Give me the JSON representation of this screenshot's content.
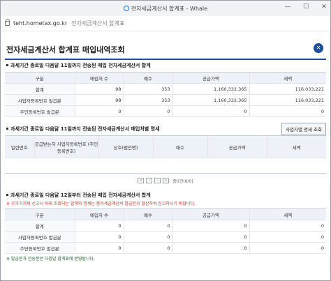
{
  "window": {
    "title": "전자세금계산서 합계표 - Whale"
  },
  "address": {
    "host": "teht.hometax.go.kr",
    "page_title": "전자세금계산서 합계표"
  },
  "header": {
    "title": "전자세금계산서 합계표 매입내역조회"
  },
  "section1": {
    "title": "과세기간 종료일 다음달 11일까지 전송된 매입 전자세금계산서 합계",
    "columns": [
      "구분",
      "매입처 수",
      "매수",
      "공급가액",
      "세액"
    ],
    "rows": [
      [
        "합계",
        "98",
        "353",
        "1,160,332,365",
        "116,033,221"
      ],
      [
        "사업자등록번호 발급분",
        "98",
        "353",
        "1,160,332,365",
        "116,033,221"
      ],
      [
        "주민등록번호 발급분",
        "0",
        "0",
        "0",
        "0"
      ]
    ]
  },
  "section2": {
    "title": "과세기간 종료일 다음달 11일까지 전송된 전자세금계산서 매입처별 명세",
    "button_label": "사업자별 명세 조회",
    "columns": [
      "일련번호",
      "공급받는자 사업자등록번호 (주민등록번호)",
      "상호(법인명)",
      "매수",
      "공급가액",
      "세액"
    ],
    "pager": {
      "text": "총0건(0/0)"
    }
  },
  "section3": {
    "title": "과세기간 종료일 다음달 12일부터 전송된 매입 전자세금계산서 합계",
    "note": "※ 부가가치세 신고시 아래 조회되는 합계와 명세는 종이세금계산서 발급분과 합산하여 신고하시기 바랍니다.",
    "columns": [
      "구분",
      "매입처 수",
      "매수",
      "공급가액",
      "세액"
    ],
    "rows": [
      [
        "합계",
        "0",
        "0",
        "0",
        "0"
      ],
      [
        "사업자등록번호 발급분",
        "0",
        "0",
        "0",
        "0"
      ],
      [
        "주민등록번호 발급분",
        "0",
        "0",
        "0",
        "0"
      ]
    ],
    "footer_note": "※ 발급분과 전송분은 다음달 합계표에 반영됩니다."
  },
  "colors": {
    "accent": "#1e4f9c",
    "header_bg": "#eef2f8",
    "note_red": "#c0392b"
  }
}
